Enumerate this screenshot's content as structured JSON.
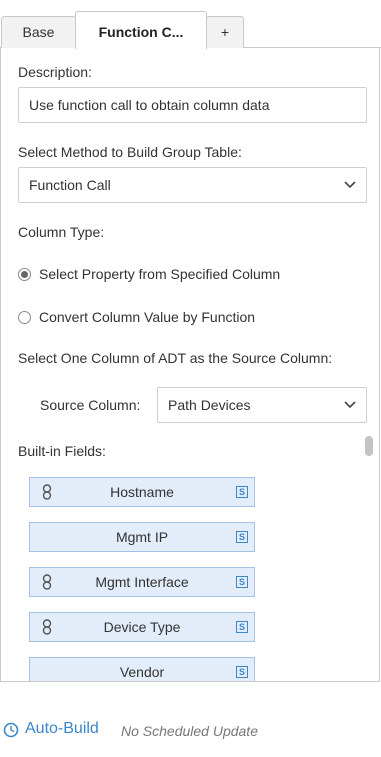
{
  "tabs": [
    {
      "label": "Base"
    },
    {
      "label": "Function C..."
    },
    {
      "label": "+"
    }
  ],
  "description": {
    "label": "Description:",
    "value": "Use function call to obtain column data"
  },
  "method": {
    "label": "Select Method to Build Group Table:",
    "value": "Function Call"
  },
  "column_type": {
    "label": "Column Type:",
    "options": [
      {
        "label": "Select Property from Specified Column",
        "checked": true
      },
      {
        "label": "Convert Column Value by Function",
        "checked": false
      }
    ]
  },
  "source": {
    "heading": "Select One Column of ADT as the Source Column:",
    "label": "Source Column:",
    "value": "Path Devices"
  },
  "builtin": {
    "label": "Built-in Fields:",
    "items": [
      {
        "label": "Hostname",
        "linked": true,
        "badge": "S"
      },
      {
        "label": "Mgmt IP",
        "linked": false,
        "badge": "S"
      },
      {
        "label": "Mgmt Interface",
        "linked": true,
        "badge": "S"
      },
      {
        "label": "Device Type",
        "linked": true,
        "badge": "S"
      },
      {
        "label": "Vendor",
        "linked": false,
        "badge": "S"
      }
    ]
  },
  "footer": {
    "auto_build": "Auto-Build",
    "schedule": "No Scheduled Update"
  },
  "colors": {
    "accent": "#3a86c8",
    "field_bg": "#e3ecf9",
    "field_border": "#a7c0e6"
  }
}
